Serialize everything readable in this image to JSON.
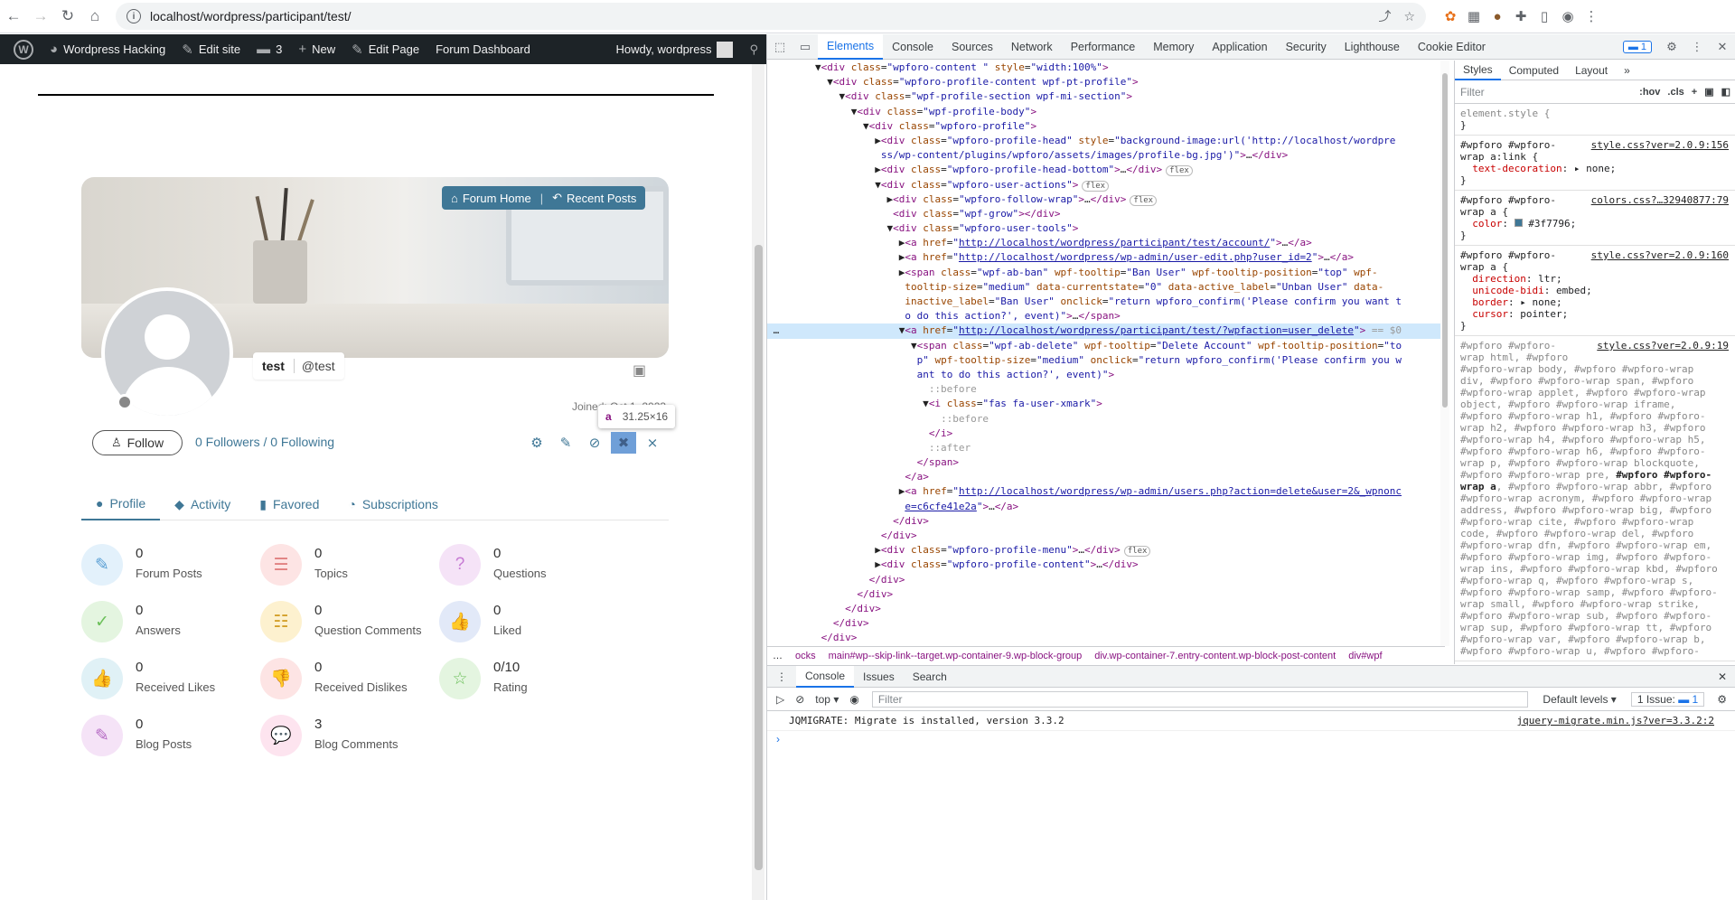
{
  "browser": {
    "url": "localhost/wordpress/participant/test/"
  },
  "adminbar": {
    "site": "Wordpress Hacking",
    "edit_site": "Edit site",
    "comments": "3",
    "new": "New",
    "edit_page": "Edit Page",
    "forum_dashboard": "Forum Dashboard",
    "howdy": "Howdy, wordpress"
  },
  "profile": {
    "forum_home": "Forum Home",
    "recent_posts": "Recent Posts",
    "display_name": "test",
    "handle": "@test",
    "joined": "Joined: Oct 1, 2023",
    "tooltip_tag": "a",
    "tooltip_dims": "31.25×16",
    "follow": "Follow",
    "follow_counts": "0 Followers / 0 Following",
    "tabs": [
      "Profile",
      "Activity",
      "Favored",
      "Subscriptions"
    ],
    "stats": [
      {
        "num": "0",
        "label": "Forum Posts",
        "bg": "#e3f1fb",
        "fg": "#5a9fd4",
        "icon": "✎"
      },
      {
        "num": "0",
        "label": "Topics",
        "bg": "#fde4e4",
        "fg": "#e08080",
        "icon": "☰"
      },
      {
        "num": "0",
        "label": "Questions",
        "bg": "#f5e3f7",
        "fg": "#c77bd4",
        "icon": "?"
      },
      {
        "num": "0",
        "label": "Answers",
        "bg": "#e4f5e0",
        "fg": "#6cc05a",
        "icon": "✓"
      },
      {
        "num": "0",
        "label": "Question Comments",
        "bg": "#fdf1cf",
        "fg": "#d4a02a",
        "icon": "☷"
      },
      {
        "num": "0",
        "label": "Liked",
        "bg": "#e2e9f8",
        "fg": "#5f82c8",
        "icon": "👍"
      },
      {
        "num": "0",
        "label": "Received Likes",
        "bg": "#e0f1f6",
        "fg": "#4ea6c2",
        "icon": "👍"
      },
      {
        "num": "0",
        "label": "Received Dislikes",
        "bg": "#fde4e4",
        "fg": "#d86a6a",
        "icon": "👎"
      },
      {
        "num": "0/10",
        "label": "Rating",
        "bg": "#e4f5e0",
        "fg": "#6cc05a",
        "icon": "☆"
      },
      {
        "num": "0",
        "label": "Blog Posts",
        "bg": "#f5e3f7",
        "fg": "#b56ac4",
        "icon": "✎"
      },
      {
        "num": "3",
        "label": "Blog Comments",
        "bg": "#fde4ef",
        "fg": "#d05c8e",
        "icon": "💬"
      }
    ]
  },
  "devtools": {
    "tabs": [
      "Elements",
      "Console",
      "Sources",
      "Network",
      "Performance",
      "Memory",
      "Application",
      "Security",
      "Lighthouse",
      "Cookie Editor"
    ],
    "issues_badge": "1",
    "style_tabs": [
      "Styles",
      "Computed",
      "Layout"
    ],
    "filter_placeholder": "Filter",
    "hov": ":hov",
    "cls": ".cls",
    "crumbs": [
      "ocks",
      "main#wp--skip-link--target.wp-container-9.wp-block-group",
      "div.wp-container-7.entry-content.wp-block-post-content",
      "div#wpf"
    ],
    "drawer_tabs": [
      "Console",
      "Issues",
      "Search"
    ],
    "context": "top",
    "console_filter": "Filter",
    "levels": "Default levels",
    "issue_count": "1 Issue:",
    "issue_badge": "1",
    "console_msg": "JQMIGRATE: Migrate is installed, version 3.3.2",
    "console_src": "jquery-migrate.min.js?ver=3.3.2:2",
    "prompt": "›"
  }
}
